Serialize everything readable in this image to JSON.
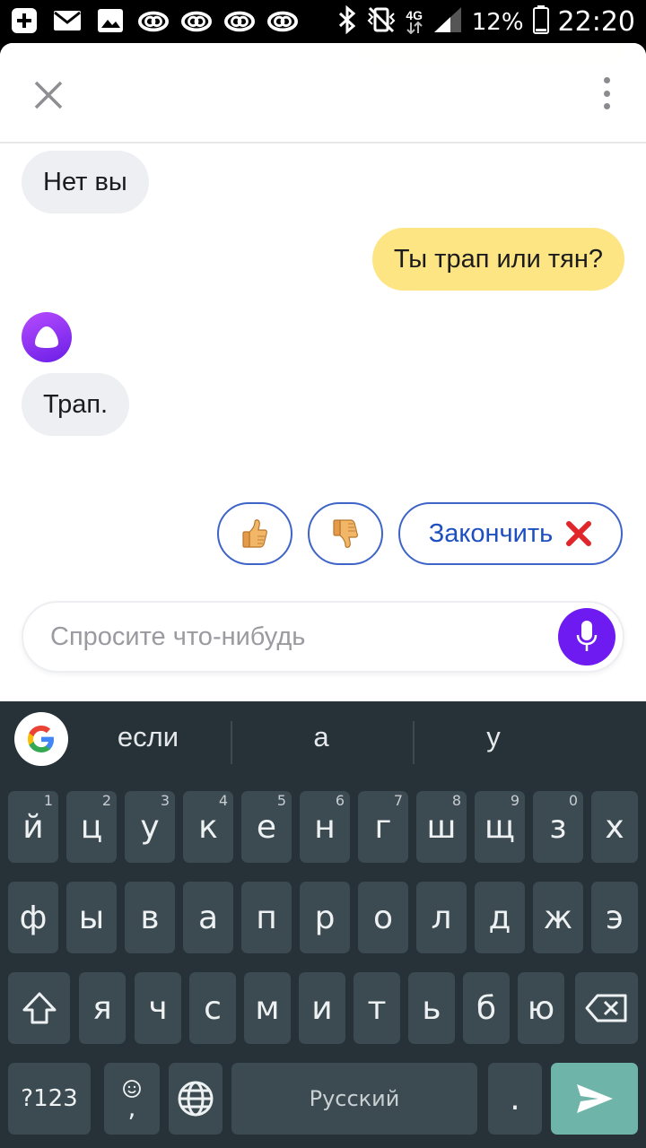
{
  "status_bar": {
    "network": "4G",
    "battery": "12%",
    "time": "22:20"
  },
  "chat": {
    "messages": [
      {
        "from": "alice",
        "text": "Нет вы"
      },
      {
        "from": "user",
        "text": "Ты трап или тян?"
      },
      {
        "from": "alice",
        "text": "Трап."
      }
    ]
  },
  "suggestions": {
    "like_icon": "thumbs-up-icon",
    "dislike_icon": "thumbs-down-icon",
    "finish_label": "Закончить"
  },
  "input": {
    "placeholder": "Спросите что-нибудь"
  },
  "keyboard": {
    "suggestions": [
      "если",
      "а",
      "у"
    ],
    "row1": [
      {
        "k": "й",
        "h": "1"
      },
      {
        "k": "ц",
        "h": "2"
      },
      {
        "k": "у",
        "h": "3"
      },
      {
        "k": "к",
        "h": "4"
      },
      {
        "k": "е",
        "h": "5"
      },
      {
        "k": "н",
        "h": "6"
      },
      {
        "k": "г",
        "h": "7"
      },
      {
        "k": "ш",
        "h": "8"
      },
      {
        "k": "щ",
        "h": "9"
      },
      {
        "k": "з",
        "h": "0"
      },
      {
        "k": "х",
        "h": ""
      }
    ],
    "row2": [
      "ф",
      "ы",
      "в",
      "а",
      "п",
      "р",
      "о",
      "л",
      "д",
      "ж",
      "э"
    ],
    "row3": [
      "я",
      "ч",
      "с",
      "м",
      "и",
      "т",
      "ь",
      "б",
      "ю"
    ],
    "symbols_label": "?123",
    "emoji_comma_label": ",",
    "space_label": "Русский",
    "period_label": "."
  },
  "colors": {
    "user_bubble": "#fde583",
    "alice_bubble": "#eeeff3",
    "accent": "#6e1bf2",
    "chip_border": "#3e64c8",
    "keyboard_bg": "#263238"
  }
}
